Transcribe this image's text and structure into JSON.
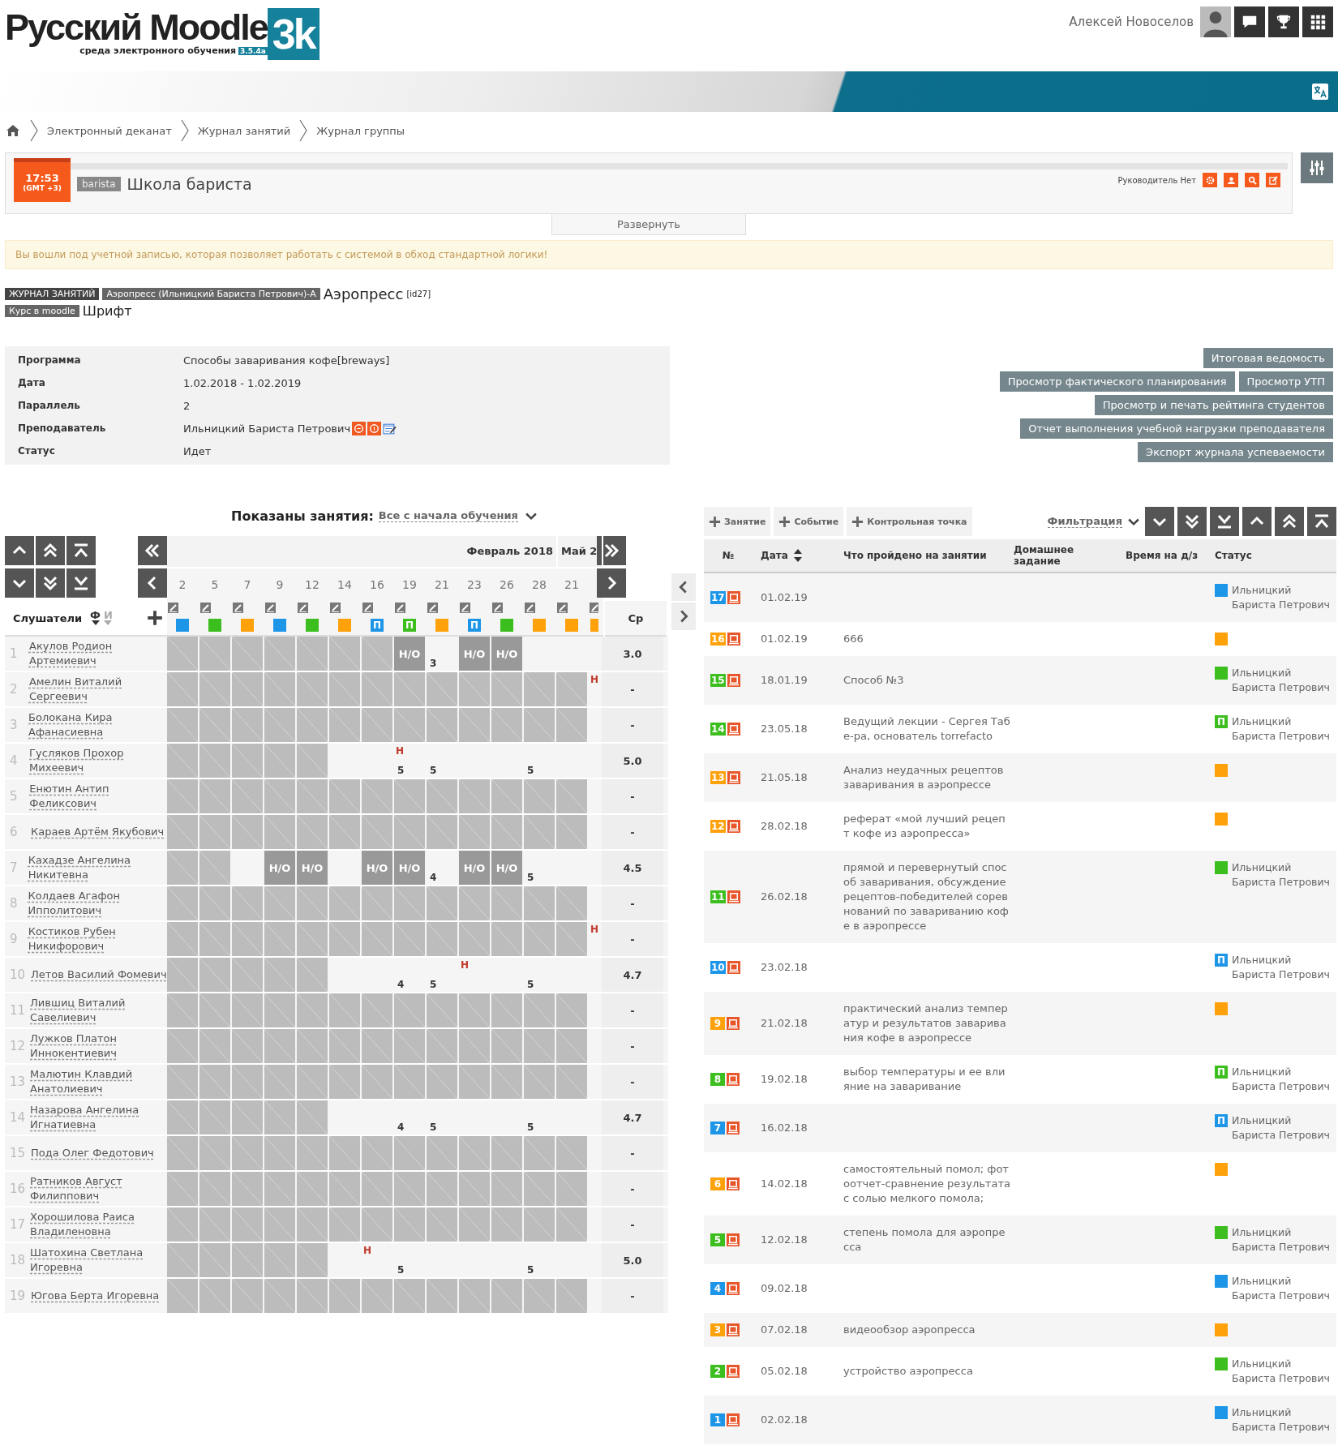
{
  "header": {
    "logo_text": "Русский Moodle",
    "logo_mark": "3k",
    "logo_subtitle": "среда электронного обучения",
    "version": "3.5.4a",
    "user_name": "Алексей Новоселов"
  },
  "breadcrumbs": [
    "Электронный деканат",
    "Журнал занятий",
    "Журнал группы"
  ],
  "group": {
    "time": "17:53",
    "timezone": "(GMT +3)",
    "tag": "barista",
    "title": "Школа бариста",
    "leader": "Руководитель Нет",
    "expand": "Развернуть"
  },
  "alert": "Вы вошли под учетной записью, которая позволяет работать с системой в обход стандартной логики!",
  "journal": {
    "tags": [
      "ЖУРНАЛ ЗАНЯТИЙ",
      "Аэропресс (Ильницкий Бариста Петрович)-А"
    ],
    "title": "Аэропресс",
    "id": "[id27]",
    "course_tag": "Курс в moodle",
    "course": "Шрифт"
  },
  "info": [
    {
      "kind": "text",
      "label": "Программа",
      "value": "Способы заваривания кофе[breways]"
    },
    {
      "kind": "text",
      "label": "Дата",
      "value": "1.02.2018 - 1.02.2019"
    },
    {
      "kind": "text",
      "label": "Параллель",
      "value": "2"
    },
    {
      "kind": "teacher",
      "label": "Преподаватель",
      "value": "Ильницкий Бариста Петрович"
    },
    {
      "kind": "text",
      "label": "Статус",
      "value": "Идет"
    }
  ],
  "report_buttons": [
    [
      "Итоговая ведомость"
    ],
    [
      "Просмотр фактического планирования",
      "Просмотр УТП"
    ],
    [
      "Просмотр и печать рейтинга студентов"
    ],
    [
      "Отчет выполнения учебной нагрузки преподавателя"
    ],
    [
      "Экспорт журнала успеваемости"
    ]
  ],
  "grid": {
    "shown_label": "Показаны занятия:",
    "shown_value": "Все с начала обучения",
    "students_label": "Слушатели",
    "average_label": "Ср",
    "sort_keys": [
      {
        "label": "Ф",
        "selected": true
      },
      {
        "label": "И",
        "selected": false
      }
    ],
    "months": [
      {
        "label": "Февраль 2018",
        "columns": [
          {
            "date": "2",
            "color": "#1e96e8",
            "cut": false
          },
          {
            "date": "5",
            "color": "#3cbe1e",
            "cut": false
          },
          {
            "date": "7",
            "color": "#ffa10a",
            "cut": false
          },
          {
            "date": "9",
            "color": "#1e96e8",
            "cut": false
          },
          {
            "date": "12",
            "color": "#3cbe1e",
            "cut": false
          },
          {
            "date": "14",
            "color": "#ffa10a",
            "cut": false
          },
          {
            "date": "16",
            "color": "#1e96e8",
            "letter": "П",
            "cut": false
          },
          {
            "date": "19",
            "color": "#3cbe1e",
            "letter": "П",
            "cut": false
          },
          {
            "date": "21",
            "color": "#ffa10a",
            "cut": false
          },
          {
            "date": "23",
            "color": "#1e96e8",
            "letter": "П",
            "cut": false
          },
          {
            "date": "26",
            "color": "#3cbe1e",
            "cut": false
          },
          {
            "date": "28",
            "color": "#ffa10a",
            "cut": false
          }
        ]
      },
      {
        "label": "Май 2",
        "columns": [
          {
            "date": "21",
            "color": "#ffa10a",
            "cut": false
          },
          {
            "color": "#ffa10a",
            "cut": true
          }
        ]
      }
    ],
    "students": [
      {
        "num": "1",
        "name": "Акулов Родион Артемиевич",
        "average": "3.0",
        "cells": [
          {
            "kind": "locked"
          },
          {
            "kind": "locked"
          },
          {
            "kind": "locked"
          },
          {
            "kind": "locked"
          },
          {
            "kind": "locked"
          },
          {
            "kind": "locked"
          },
          {
            "kind": "locked"
          },
          {
            "kind": "absent",
            "text": "Н/О"
          },
          {
            "kind": "grade",
            "text": "3"
          },
          {
            "kind": "absent",
            "text": "Н/О"
          },
          {
            "kind": "absent",
            "text": "Н/О"
          },
          {
            "kind": "blank"
          },
          {
            "kind": "blank"
          },
          {
            "kind": "blank"
          }
        ]
      },
      {
        "num": "2",
        "name": "Амелин Виталий Сергеевич",
        "average": "-",
        "cells": [
          {
            "kind": "locked"
          },
          {
            "kind": "locked"
          },
          {
            "kind": "locked"
          },
          {
            "kind": "locked"
          },
          {
            "kind": "locked"
          },
          {
            "kind": "locked"
          },
          {
            "kind": "locked"
          },
          {
            "kind": "locked"
          },
          {
            "kind": "locked"
          },
          {
            "kind": "locked"
          },
          {
            "kind": "locked"
          },
          {
            "kind": "locked"
          },
          {
            "kind": "locked"
          },
          {
            "kind": "mark",
            "text": "Н"
          }
        ]
      },
      {
        "num": "3",
        "name": "Болокана Кира Афанасиевна",
        "average": "-",
        "cells": [
          {
            "kind": "locked"
          },
          {
            "kind": "locked"
          },
          {
            "kind": "locked"
          },
          {
            "kind": "locked"
          },
          {
            "kind": "locked"
          },
          {
            "kind": "locked"
          },
          {
            "kind": "locked"
          },
          {
            "kind": "locked"
          },
          {
            "kind": "locked"
          },
          {
            "kind": "locked"
          },
          {
            "kind": "locked"
          },
          {
            "kind": "locked"
          },
          {
            "kind": "locked"
          },
          {
            "kind": "blank"
          }
        ]
      },
      {
        "num": "4",
        "name": "Гусляков Прохор Михеевич",
        "average": "5.0",
        "cells": [
          {
            "kind": "locked"
          },
          {
            "kind": "locked"
          },
          {
            "kind": "locked"
          },
          {
            "kind": "locked"
          },
          {
            "kind": "locked"
          },
          {
            "kind": "blank"
          },
          {
            "kind": "blank"
          },
          {
            "kind": "grade",
            "text": "5",
            "note": "Н"
          },
          {
            "kind": "grade",
            "text": "5"
          },
          {
            "kind": "blank"
          },
          {
            "kind": "blank"
          },
          {
            "kind": "grade",
            "text": "5"
          },
          {
            "kind": "blank"
          },
          {
            "kind": "blank"
          }
        ]
      },
      {
        "num": "5",
        "name": "Енютин Антип Феликсович",
        "average": "-",
        "cells": [
          {
            "kind": "locked"
          },
          {
            "kind": "locked"
          },
          {
            "kind": "locked"
          },
          {
            "kind": "locked"
          },
          {
            "kind": "locked"
          },
          {
            "kind": "locked"
          },
          {
            "kind": "locked"
          },
          {
            "kind": "locked"
          },
          {
            "kind": "locked"
          },
          {
            "kind": "locked"
          },
          {
            "kind": "locked"
          },
          {
            "kind": "locked"
          },
          {
            "kind": "locked"
          },
          {
            "kind": "blank"
          }
        ]
      },
      {
        "num": "6",
        "name": "Караев Артём Якубович",
        "average": "-",
        "cells": [
          {
            "kind": "locked"
          },
          {
            "kind": "locked"
          },
          {
            "kind": "locked"
          },
          {
            "kind": "locked"
          },
          {
            "kind": "locked"
          },
          {
            "kind": "locked"
          },
          {
            "kind": "locked"
          },
          {
            "kind": "locked"
          },
          {
            "kind": "locked"
          },
          {
            "kind": "locked"
          },
          {
            "kind": "locked"
          },
          {
            "kind": "locked"
          },
          {
            "kind": "locked"
          },
          {
            "kind": "blank"
          }
        ]
      },
      {
        "num": "7",
        "name": "Кахадзе Ангелина Никитевна",
        "average": "4.5",
        "cells": [
          {
            "kind": "locked"
          },
          {
            "kind": "locked"
          },
          {
            "kind": "blank"
          },
          {
            "kind": "absent",
            "text": "Н/О"
          },
          {
            "kind": "absent",
            "text": "Н/О"
          },
          {
            "kind": "blank"
          },
          {
            "kind": "absent",
            "text": "Н/О"
          },
          {
            "kind": "absent",
            "text": "Н/О"
          },
          {
            "kind": "grade",
            "text": "4"
          },
          {
            "kind": "absent",
            "text": "Н/О"
          },
          {
            "kind": "absent",
            "text": "Н/О"
          },
          {
            "kind": "grade",
            "text": "5"
          },
          {
            "kind": "blank"
          },
          {
            "kind": "blank"
          }
        ]
      },
      {
        "num": "8",
        "name": "Колдаев Агафон Ипполитович",
        "average": "-",
        "cells": [
          {
            "kind": "locked"
          },
          {
            "kind": "locked"
          },
          {
            "kind": "locked"
          },
          {
            "kind": "locked"
          },
          {
            "kind": "locked"
          },
          {
            "kind": "locked"
          },
          {
            "kind": "locked"
          },
          {
            "kind": "locked"
          },
          {
            "kind": "locked"
          },
          {
            "kind": "locked"
          },
          {
            "kind": "locked"
          },
          {
            "kind": "locked"
          },
          {
            "kind": "locked"
          },
          {
            "kind": "blank"
          }
        ]
      },
      {
        "num": "9",
        "name": "Костиков Рубен Никифорович",
        "average": "-",
        "cells": [
          {
            "kind": "locked"
          },
          {
            "kind": "locked"
          },
          {
            "kind": "locked"
          },
          {
            "kind": "locked"
          },
          {
            "kind": "locked"
          },
          {
            "kind": "locked"
          },
          {
            "kind": "locked"
          },
          {
            "kind": "locked"
          },
          {
            "kind": "locked"
          },
          {
            "kind": "locked"
          },
          {
            "kind": "locked"
          },
          {
            "kind": "locked"
          },
          {
            "kind": "locked"
          },
          {
            "kind": "mark",
            "text": "Н"
          }
        ]
      },
      {
        "num": "10",
        "name": "Летов Василий Фомевич",
        "average": "4.7",
        "cells": [
          {
            "kind": "locked"
          },
          {
            "kind": "locked"
          },
          {
            "kind": "locked"
          },
          {
            "kind": "locked"
          },
          {
            "kind": "locked"
          },
          {
            "kind": "blank"
          },
          {
            "kind": "blank"
          },
          {
            "kind": "grade",
            "text": "4"
          },
          {
            "kind": "grade",
            "text": "5"
          },
          {
            "kind": "mark",
            "text": "Н"
          },
          {
            "kind": "blank"
          },
          {
            "kind": "grade",
            "text": "5"
          },
          {
            "kind": "blank"
          },
          {
            "kind": "blank"
          }
        ]
      },
      {
        "num": "11",
        "name": "Лившиц Виталий Савелиевич",
        "average": "-",
        "cells": [
          {
            "kind": "locked"
          },
          {
            "kind": "locked"
          },
          {
            "kind": "locked"
          },
          {
            "kind": "locked"
          },
          {
            "kind": "locked"
          },
          {
            "kind": "locked"
          },
          {
            "kind": "locked"
          },
          {
            "kind": "locked"
          },
          {
            "kind": "locked"
          },
          {
            "kind": "locked"
          },
          {
            "kind": "locked"
          },
          {
            "kind": "locked"
          },
          {
            "kind": "locked"
          },
          {
            "kind": "blank"
          }
        ]
      },
      {
        "num": "12",
        "name": "Лужков Платон Иннокентиевич",
        "average": "-",
        "cells": [
          {
            "kind": "locked"
          },
          {
            "kind": "locked"
          },
          {
            "kind": "locked"
          },
          {
            "kind": "locked"
          },
          {
            "kind": "locked"
          },
          {
            "kind": "locked"
          },
          {
            "kind": "locked"
          },
          {
            "kind": "locked"
          },
          {
            "kind": "locked"
          },
          {
            "kind": "locked"
          },
          {
            "kind": "locked"
          },
          {
            "kind": "locked"
          },
          {
            "kind": "locked"
          },
          {
            "kind": "blank"
          }
        ]
      },
      {
        "num": "13",
        "name": "Малютин Клавдий Анатолиевич",
        "average": "-",
        "cells": [
          {
            "kind": "locked"
          },
          {
            "kind": "locked"
          },
          {
            "kind": "locked"
          },
          {
            "kind": "locked"
          },
          {
            "kind": "locked"
          },
          {
            "kind": "locked"
          },
          {
            "kind": "locked"
          },
          {
            "kind": "locked"
          },
          {
            "kind": "locked"
          },
          {
            "kind": "locked"
          },
          {
            "kind": "locked"
          },
          {
            "kind": "locked"
          },
          {
            "kind": "locked"
          },
          {
            "kind": "blank"
          }
        ]
      },
      {
        "num": "14",
        "name": "Назарова Ангелина Игнатиевна",
        "average": "4.7",
        "cells": [
          {
            "kind": "locked"
          },
          {
            "kind": "locked"
          },
          {
            "kind": "locked"
          },
          {
            "kind": "locked"
          },
          {
            "kind": "locked"
          },
          {
            "kind": "blank"
          },
          {
            "kind": "blank"
          },
          {
            "kind": "grade",
            "text": "4"
          },
          {
            "kind": "grade",
            "text": "5"
          },
          {
            "kind": "blank"
          },
          {
            "kind": "blank"
          },
          {
            "kind": "grade",
            "text": "5"
          },
          {
            "kind": "blank"
          },
          {
            "kind": "blank"
          }
        ]
      },
      {
        "num": "15",
        "name": "Пода Олег Федотович",
        "average": "-",
        "cells": [
          {
            "kind": "locked"
          },
          {
            "kind": "locked"
          },
          {
            "kind": "locked"
          },
          {
            "kind": "locked"
          },
          {
            "kind": "locked"
          },
          {
            "kind": "locked"
          },
          {
            "kind": "locked"
          },
          {
            "kind": "locked"
          },
          {
            "kind": "locked"
          },
          {
            "kind": "locked"
          },
          {
            "kind": "locked"
          },
          {
            "kind": "locked"
          },
          {
            "kind": "locked"
          },
          {
            "kind": "blank"
          }
        ]
      },
      {
        "num": "16",
        "name": "Ратников Август Филиппович",
        "average": "-",
        "cells": [
          {
            "kind": "locked"
          },
          {
            "kind": "locked"
          },
          {
            "kind": "locked"
          },
          {
            "kind": "locked"
          },
          {
            "kind": "locked"
          },
          {
            "kind": "locked"
          },
          {
            "kind": "locked"
          },
          {
            "kind": "locked"
          },
          {
            "kind": "locked"
          },
          {
            "kind": "locked"
          },
          {
            "kind": "locked"
          },
          {
            "kind": "locked"
          },
          {
            "kind": "locked"
          },
          {
            "kind": "blank"
          }
        ]
      },
      {
        "num": "17",
        "name": "Хорошилова Раиса Владиленовна",
        "average": "-",
        "cells": [
          {
            "kind": "locked"
          },
          {
            "kind": "locked"
          },
          {
            "kind": "locked"
          },
          {
            "kind": "locked"
          },
          {
            "kind": "locked"
          },
          {
            "kind": "locked"
          },
          {
            "kind": "locked"
          },
          {
            "kind": "locked"
          },
          {
            "kind": "locked"
          },
          {
            "kind": "locked"
          },
          {
            "kind": "locked"
          },
          {
            "kind": "locked"
          },
          {
            "kind": "locked"
          },
          {
            "kind": "blank"
          }
        ]
      },
      {
        "num": "18",
        "name": "Шатохина Светлана Игоревна",
        "average": "5.0",
        "cells": [
          {
            "kind": "locked"
          },
          {
            "kind": "locked"
          },
          {
            "kind": "locked"
          },
          {
            "kind": "locked"
          },
          {
            "kind": "locked"
          },
          {
            "kind": "blank"
          },
          {
            "kind": "mark",
            "text": "Н"
          },
          {
            "kind": "grade",
            "text": "5"
          },
          {
            "kind": "blank"
          },
          {
            "kind": "blank"
          },
          {
            "kind": "blank"
          },
          {
            "kind": "grade",
            "text": "5"
          },
          {
            "kind": "blank"
          },
          {
            "kind": "blank"
          }
        ]
      },
      {
        "num": "19",
        "name": "Югова Берта Игоревна",
        "average": "-",
        "cells": [
          {
            "kind": "locked"
          },
          {
            "kind": "locked"
          },
          {
            "kind": "locked"
          },
          {
            "kind": "locked"
          },
          {
            "kind": "locked"
          },
          {
            "kind": "locked"
          },
          {
            "kind": "locked"
          },
          {
            "kind": "locked"
          },
          {
            "kind": "locked"
          },
          {
            "kind": "locked"
          },
          {
            "kind": "locked"
          },
          {
            "kind": "locked"
          },
          {
            "kind": "locked"
          },
          {
            "kind": "blank"
          }
        ]
      }
    ]
  },
  "lessons": {
    "toolbar": [
      "Занятие",
      "Событие",
      "Контрольная точка"
    ],
    "filter": "Фильтрация",
    "columns": [
      "№",
      "Дата",
      "Что пройдено на занятии",
      "Домашнее задание",
      "Время на д/з",
      "Статус"
    ],
    "rows": [
      {
        "num": "17",
        "color": "#1e96e8",
        "date": "01.02.19",
        "teacher": "Ильницкий Бариста Петрович"
      },
      {
        "num": "16",
        "color": "#ffa10a",
        "date": "01.02.19",
        "topic": "666"
      },
      {
        "num": "15",
        "color": "#3cbe1e",
        "date": "18.01.19",
        "topic": "Способ №3",
        "teacher": "Ильницкий Бариста Петрович"
      },
      {
        "num": "14",
        "color": "#3cbe1e",
        "date": "23.05.18",
        "topic": "Ведущий лекции - Сергея Табе-ра, основатель torrefacto",
        "letter": "П",
        "teacher": "Ильницкий Бариста Петрович"
      },
      {
        "num": "13",
        "color": "#ffa10a",
        "date": "21.05.18",
        "topic": "Анализ неудачных рецептов заваривания в аэропрессе"
      },
      {
        "num": "12",
        "color": "#ffa10a",
        "date": "28.02.18",
        "topic": "реферат «мой лучший рецепт кофе из аэропресса»"
      },
      {
        "num": "11",
        "color": "#3cbe1e",
        "date": "26.02.18",
        "topic": "прямой и перевернутый способ заваривания, обсуждение рецептов-победителей соревнований по завариванию кофе в аэропрессе",
        "teacher": "Ильницкий Бариста Петрович"
      },
      {
        "num": "10",
        "color": "#1e96e8",
        "date": "23.02.18",
        "letter": "П",
        "teacher": "Ильницкий Бариста Петрович"
      },
      {
        "num": "9",
        "color": "#ffa10a",
        "date": "21.02.18",
        "topic": "практический анализ температур и результатов заваривания кофе в аэропрессе"
      },
      {
        "num": "8",
        "color": "#3cbe1e",
        "date": "19.02.18",
        "topic": "выбор температуры и ее влияние на заваривание",
        "letter": "П",
        "teacher": "Ильницкий Бариста Петрович"
      },
      {
        "num": "7",
        "color": "#1e96e8",
        "date": "16.02.18",
        "letter": "П",
        "teacher": "Ильницкий Бариста Петрович"
      },
      {
        "num": "6",
        "color": "#ffa10a",
        "date": "14.02.18",
        "topic": "самостоятельный помол; фотоотчет-сравнение результата с солью мелкого помола;"
      },
      {
        "num": "5",
        "color": "#3cbe1e",
        "date": "12.02.18",
        "topic": "степень помола для аэропресса",
        "teacher": "Ильницкий Бариста Петрович"
      },
      {
        "num": "4",
        "color": "#1e96e8",
        "date": "09.02.18",
        "teacher": "Ильницкий Бариста Петрович"
      },
      {
        "num": "3",
        "color": "#ffa10a",
        "date": "07.02.18",
        "topic": "видеообзор аэропресса"
      },
      {
        "num": "2",
        "color": "#3cbe1e",
        "date": "05.02.18",
        "topic": "устройство аэропресса",
        "teacher": "Ильницкий Бариста Петрович"
      },
      {
        "num": "1",
        "color": "#1e96e8",
        "date": "02.02.18",
        "teacher": "Ильницкий Бариста Петрович"
      }
    ]
  }
}
